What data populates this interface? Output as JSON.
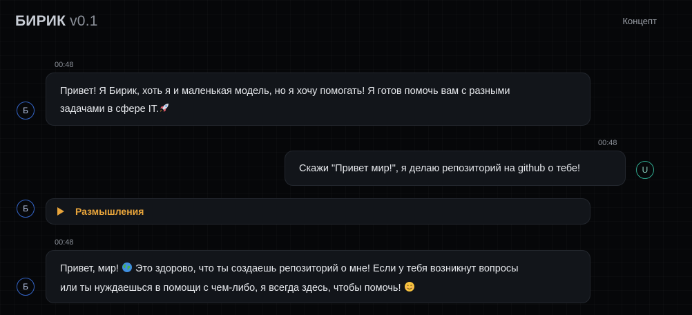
{
  "header": {
    "app_name": "БИРИК",
    "version": "v0.1",
    "nav_link": "Концепт"
  },
  "messages": [
    {
      "role": "bot",
      "avatar": "Б",
      "time": "00:48",
      "text_line1": "Привет! Я Бирик, хоть я и маленькая модель, но я хочу помогать! Я готов помочь вам с разными",
      "text_line2": "задачами в сфере IT.",
      "emoji": "rocket-emoji"
    },
    {
      "role": "user",
      "avatar": "U",
      "time": "00:48",
      "text": "Скажи \"Привет мир!\", я делаю репозиторий на github о тебе!"
    },
    {
      "role": "bot",
      "avatar": "Б",
      "thinking_label": "Размышления",
      "icon": "play-triangle-icon"
    },
    {
      "role": "bot",
      "avatar": "Б",
      "time": "00:48",
      "text_line1a": "Привет, мир!",
      "text_line1b": "Это здорово, что ты создаешь репозиторий о мне! Если у тебя возникнут вопросы",
      "text_line2": "или ты нуждаешься в помощи с чем-либо, я всегда здесь, чтобы помочь!",
      "emojis": [
        "globe-emoji",
        "smiling-face-emoji"
      ]
    }
  ],
  "colors": {
    "background": "#060709",
    "bubble": "#12151a",
    "bot_avatar_border": "#3465c8",
    "user_avatar_border": "#2fa88e",
    "thinking_accent": "#e9a53b"
  }
}
